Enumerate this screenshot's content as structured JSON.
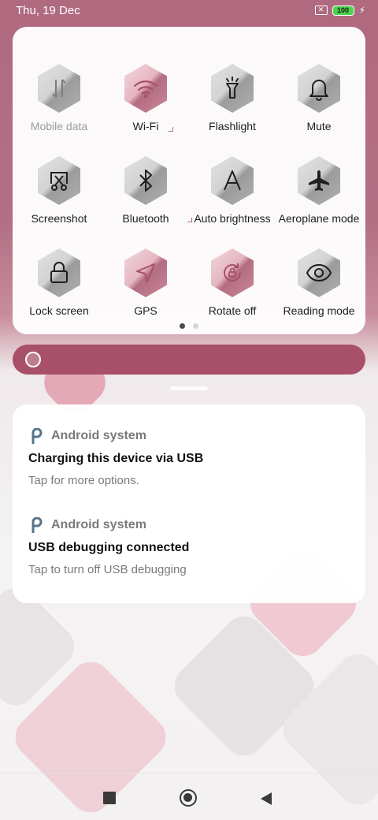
{
  "status_bar": {
    "time": "Thu, 19 Dec",
    "battery": "100"
  },
  "quick_settings": {
    "tiles": [
      {
        "label": "Mobile data",
        "icon": "mobile-data-icon",
        "active": false,
        "disabled": true
      },
      {
        "label": "Wi-Fi",
        "icon": "wifi-icon",
        "active": true,
        "disabled": false
      },
      {
        "label": "Flashlight",
        "icon": "flashlight-icon",
        "active": false,
        "disabled": false
      },
      {
        "label": "Mute",
        "icon": "bell-icon",
        "active": false,
        "disabled": false
      },
      {
        "label": "Screenshot",
        "icon": "scissors-icon",
        "active": false,
        "disabled": false
      },
      {
        "label": "Bluetooth",
        "icon": "bluetooth-icon",
        "active": false,
        "disabled": false
      },
      {
        "label": "Auto brightness",
        "icon": "auto-brightness-icon",
        "active": false,
        "disabled": false
      },
      {
        "label": "Aeroplane mode",
        "icon": "airplane-icon",
        "active": false,
        "disabled": false
      },
      {
        "label": "Lock screen",
        "icon": "lock-icon",
        "active": false,
        "disabled": false
      },
      {
        "label": "GPS",
        "icon": "location-arrow-icon",
        "active": true,
        "disabled": false
      },
      {
        "label": "Rotate off",
        "icon": "rotate-lock-icon",
        "active": true,
        "disabled": false
      },
      {
        "label": "Reading mode",
        "icon": "eye-icon",
        "active": false,
        "disabled": false
      }
    ],
    "page_count": 2,
    "current_page": 1
  },
  "brightness": {
    "level": 0
  },
  "notifications": [
    {
      "app": "Android system",
      "title": "Charging this device via USB",
      "text": "Tap for more options."
    },
    {
      "app": "Android system",
      "title": "USB debugging connected",
      "text": "Tap to turn off USB debugging"
    }
  ],
  "colors": {
    "accent": "#a85069",
    "panel_bg": "#ffffff",
    "battery_green": "#4cd34c"
  },
  "nav_bar": {
    "recents_icon": "square-icon",
    "home_icon": "circle-icon",
    "back_icon": "triangle-back-icon"
  }
}
